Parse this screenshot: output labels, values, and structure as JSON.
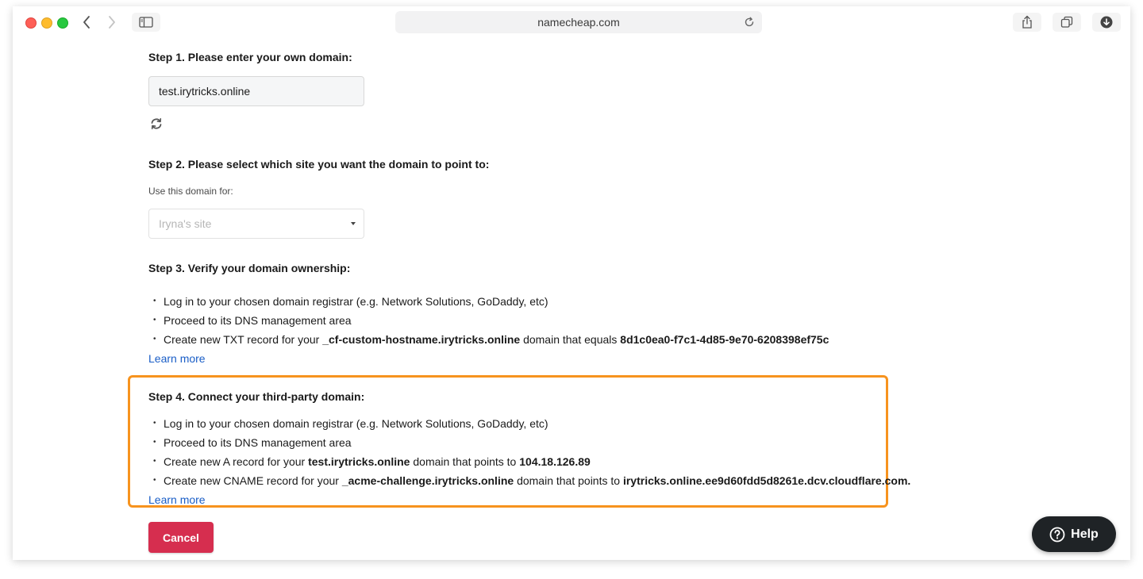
{
  "browser": {
    "address": "namecheap.com",
    "icons": {
      "back": "chevron-left-icon",
      "forward": "chevron-right-icon",
      "sidebar": "sidebar-icon",
      "reload": "reload-icon",
      "share": "share-icon",
      "tabs": "tabs-overview-icon",
      "download": "download-icon"
    }
  },
  "step1": {
    "title": "Step 1. Please enter your own domain:",
    "domain_value": "test.irytricks.online",
    "refresh_icon": "refresh-icon"
  },
  "step2": {
    "title": "Step 2. Please select which site you want the domain to point to:",
    "label": "Use this domain for:",
    "selected_site": "Iryna's site"
  },
  "step3": {
    "title": "Step 3. Verify your domain ownership:",
    "items": [
      {
        "text": "Log in to your chosen domain registrar (e.g. Network Solutions, GoDaddy, etc)"
      },
      {
        "text": "Proceed to its DNS management area"
      },
      {
        "prefix": "Create new TXT record for your ",
        "host": "_cf-custom-hostname.irytricks.online",
        "middle": " domain that equals ",
        "value": "8d1c0ea0-f7c1-4d85-9e70-6208398ef75c"
      }
    ],
    "learn_more": "Learn more"
  },
  "step4": {
    "title": "Step 4. Connect your third-party domain:",
    "items": [
      {
        "text": "Log in to your chosen domain registrar (e.g. Network Solutions, GoDaddy, etc)"
      },
      {
        "text": "Proceed to its DNS management area"
      },
      {
        "prefix": "Create new A record for your ",
        "host": "test.irytricks.online",
        "middle": " domain that points to ",
        "value": "104.18.126.89"
      },
      {
        "prefix": "Create new CNAME record for your ",
        "host": "_acme-challenge.irytricks.online",
        "middle": " domain that points to ",
        "value": "irytricks.online.ee9d60fdd5d8261e.dcv.cloudflare.com."
      }
    ],
    "learn_more": "Learn more",
    "highlight_color": "#f7931e"
  },
  "actions": {
    "cancel_label": "Cancel",
    "cancel_color": "#d62e4f"
  },
  "help": {
    "label": "Help",
    "icon": "question-circle-icon"
  }
}
